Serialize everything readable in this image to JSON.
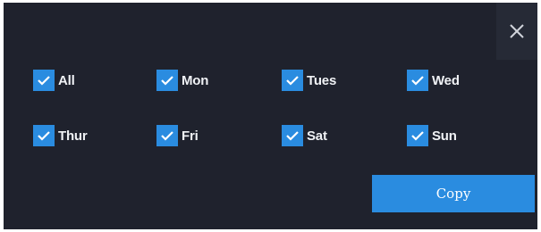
{
  "dialog": {
    "close_icon": "close-icon",
    "accent_color": "#2a8ce0",
    "background_color": "#1f222d",
    "days": [
      {
        "key": "all",
        "label": "All",
        "checked": true
      },
      {
        "key": "mon",
        "label": "Mon",
        "checked": true
      },
      {
        "key": "tues",
        "label": "Tues",
        "checked": true
      },
      {
        "key": "wed",
        "label": "Wed",
        "checked": true
      },
      {
        "key": "thur",
        "label": "Thur",
        "checked": true
      },
      {
        "key": "fri",
        "label": "Fri",
        "checked": true
      },
      {
        "key": "sat",
        "label": "Sat",
        "checked": true
      },
      {
        "key": "sun",
        "label": "Sun",
        "checked": true
      }
    ],
    "copy_label": "Copy"
  }
}
